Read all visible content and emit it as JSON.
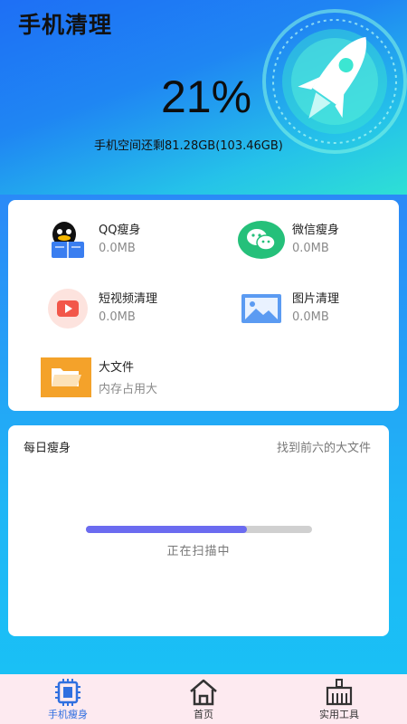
{
  "app": {
    "title": "手机清理"
  },
  "storage": {
    "percent_text": "21%",
    "space_text": "手机空间还剩81.28GB(103.46GB)"
  },
  "cleaners": [
    {
      "name": "QQ瘦身",
      "value": "0.0MB",
      "icon": "qq-penguin-icon"
    },
    {
      "name": "微信瘦身",
      "value": "0.0MB",
      "icon": "wechat-icon"
    },
    {
      "name": "短视频清理",
      "value": "0.0MB",
      "icon": "video-play-icon"
    },
    {
      "name": "图片清理",
      "value": "0.0MB",
      "icon": "picture-icon"
    },
    {
      "name": "大文件",
      "value": "内存占用大",
      "icon": "folder-icon"
    }
  ],
  "daily": {
    "title": "每日瘦身",
    "status": "找到前六的大文件",
    "progress": 0.71,
    "scan_text": "正在扫描中"
  },
  "tabs": [
    {
      "label": "手机瘦身",
      "icon": "chip-icon",
      "active": true,
      "color": "#2f6fe0"
    },
    {
      "label": "首页",
      "icon": "home-icon",
      "active": false,
      "color": "#333333"
    },
    {
      "label": "实用工具",
      "icon": "broom-icon",
      "active": false,
      "color": "#333333"
    }
  ],
  "colors": {
    "accent": "#6b6bf0",
    "header_start": "#1e6ff5",
    "header_end": "#2ee0d5"
  }
}
